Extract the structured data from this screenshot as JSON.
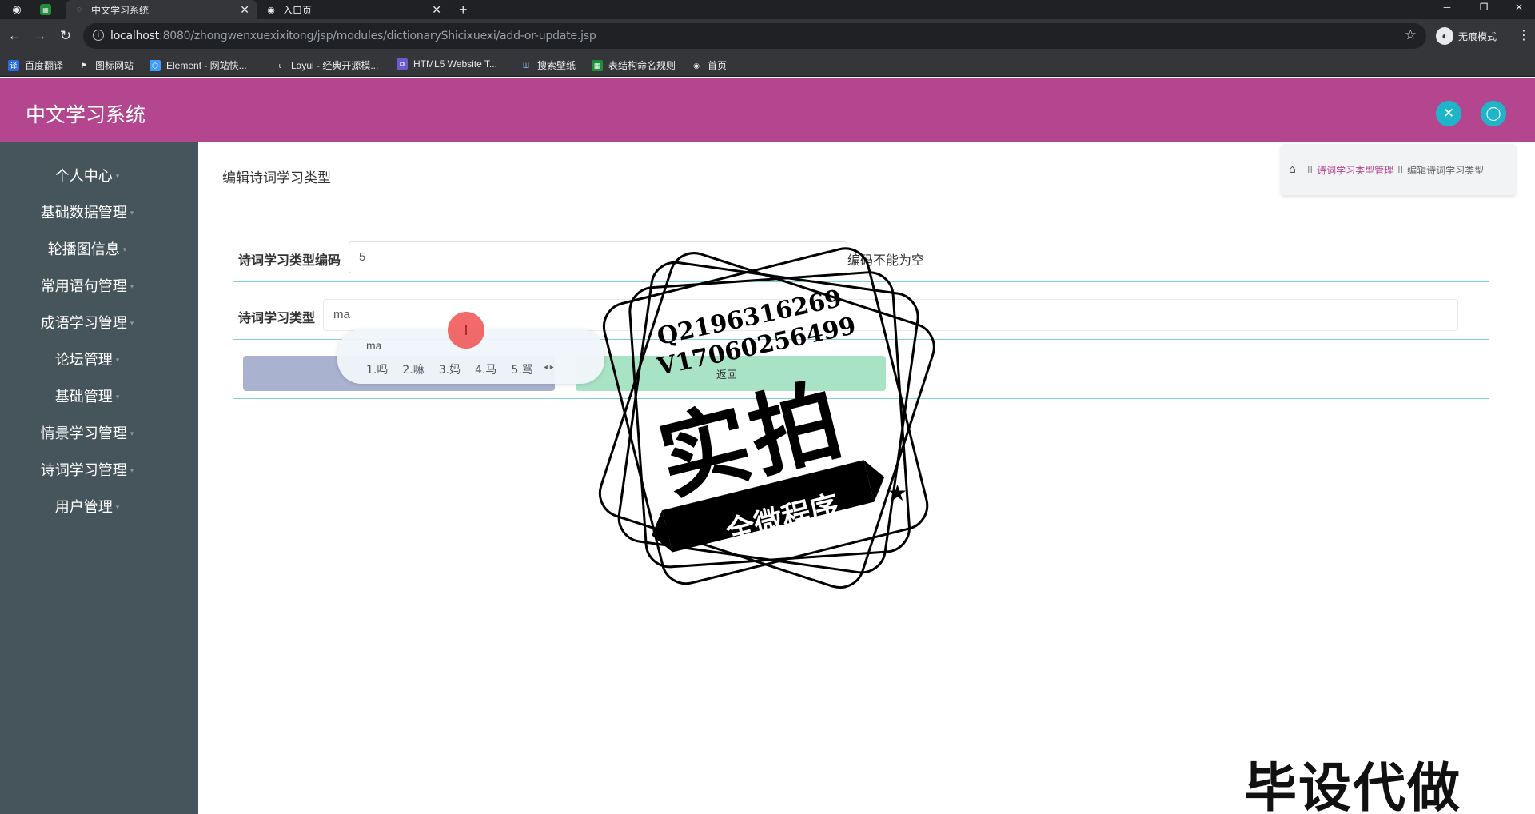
{
  "browser": {
    "tabs": [
      {
        "label": "中文学习系统",
        "active": true
      },
      {
        "label": "入口页",
        "active": false
      }
    ],
    "url_host": "localhost",
    "url_rest": ":8080/zhongwenxuexixitong/jsp/modules/dictionaryShicixuexi/add-or-update.jsp",
    "incognito_label": "无痕模式",
    "bookmarks": [
      "百度翻译",
      "图标网站",
      "Element - 网站快...",
      "Layui - 经典开源模...",
      "HTML5 Website T...",
      "搜索壁纸",
      "表结构命名规则",
      "首页"
    ]
  },
  "app": {
    "title": "中文学习系统",
    "accent_color": "#b3468f",
    "header_buttons": [
      "fullscreen-icon",
      "user-icon"
    ]
  },
  "sidebar": {
    "items": [
      {
        "label": "个人中心"
      },
      {
        "label": "基础数据管理"
      },
      {
        "label": "轮播图信息"
      },
      {
        "label": "常用语句管理"
      },
      {
        "label": "成语学习管理"
      },
      {
        "label": "论坛管理"
      },
      {
        "label": "基础管理"
      },
      {
        "label": "情景学习管理"
      },
      {
        "label": "诗词学习管理"
      },
      {
        "label": "用户管理"
      }
    ]
  },
  "main": {
    "page_title": "编辑诗词学习类型",
    "breadcrumb": {
      "sep": "II",
      "parent": "诗词学习类型管理",
      "current": "编辑诗词学习类型"
    },
    "form": {
      "code_label": "诗词学习类型编码",
      "code_value": "5",
      "code_error": "编码不能为空",
      "type_label": "诗词学习类型",
      "type_value": "ma"
    },
    "buttons": {
      "back_label": "返回"
    }
  },
  "ime": {
    "composition": "ma",
    "candidates": [
      "1.吗",
      "2.嘛",
      "3.妈",
      "4.马",
      "5.骂"
    ]
  },
  "watermark": {
    "line1": "Q2196316269",
    "line2": "V17060256499",
    "big": "实拍",
    "banner": "全微程序",
    "corner": "毕设代做"
  }
}
